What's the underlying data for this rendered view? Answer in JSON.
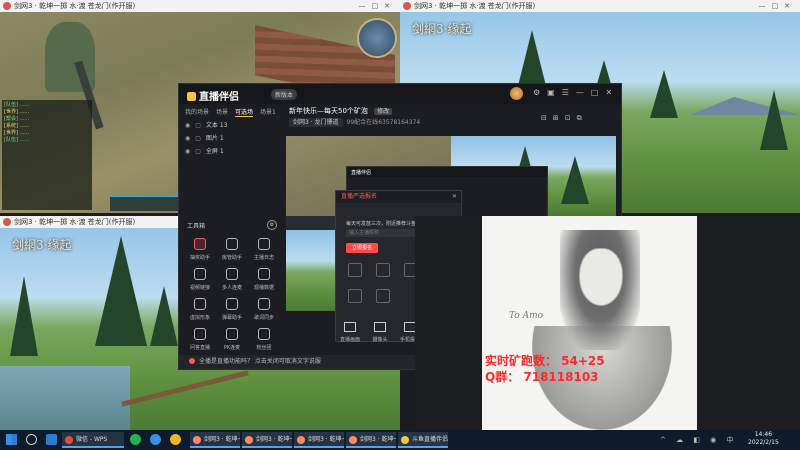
{
  "windows": {
    "top_left": {
      "title": "剑网3 · 乾坤一掷 水·渡 苍龙门(作开服)"
    },
    "top_right": {
      "title": "剑网3 · 乾坤一掷 水·渡 苍龙门(作开服)",
      "logo": "剑網3·缘起"
    },
    "bottom_left": {
      "title": "剑网3 · 乾坤一掷 水·渡 苍龙门(作开服)",
      "logo": "剑網3·缘起"
    }
  },
  "app": {
    "brand": "直播伴侣",
    "badge": "新版本",
    "tabs": [
      "我的场景",
      "场景",
      "可选场",
      "场景1"
    ],
    "active_tab_index": 2,
    "scenes": [
      {
        "label": "文本 13"
      },
      {
        "label": "图片 1"
      },
      {
        "label": "全屏 1"
      }
    ],
    "stream_title": "新年快乐—每天50个矿泡",
    "stream_tag": "修改",
    "stats": [
      "剑网3 · 龙门镖道",
      "99配合在线",
      "6357816",
      "4374"
    ],
    "header_icons": [
      "⚙",
      "▣",
      "☰",
      "—",
      "□",
      "✕"
    ],
    "toolbar_icons": [
      "⊟",
      "⊞",
      "⊡",
      "⧉"
    ],
    "tools": {
      "header": "工具箱",
      "settings_label": "⚙",
      "items": [
        {
          "label": "抽奖助手",
          "red": true
        },
        {
          "label": "房管助手",
          "red": false
        },
        {
          "label": "主播日志",
          "red": false
        },
        {
          "label": "视频链接",
          "red": false
        },
        {
          "label": "多人连麦",
          "red": false
        },
        {
          "label": "观播数据",
          "red": false
        },
        {
          "label": "虚拟形象",
          "red": false
        },
        {
          "label": "弹幕助手",
          "red": false
        },
        {
          "label": "歌词同步",
          "red": false
        },
        {
          "label": "问答直播",
          "red": false
        },
        {
          "label": "PK连麦",
          "red": false
        },
        {
          "label": "粉丝团",
          "red": false
        }
      ]
    },
    "notice": "全播是直播功能吗？ 点击关闭可取消文字说服",
    "bottom_actions": [
      "直播画面",
      "摄像头",
      "手机投屏"
    ]
  },
  "preview": {
    "inner_brand": "直播伴侣"
  },
  "popup": {
    "title": "直播严选报名",
    "close": "✕",
    "text": "每天可发放三次，附近推荐斗鱼",
    "input_placeholder": "输入主播昵称",
    "button": "立即报名"
  },
  "portrait": {
    "signature": "To Amo",
    "line1": "实时矿跑数：  54+25",
    "line2": "Q群：  718118103"
  },
  "taskbar": {
    "tasks": [
      {
        "label": "微信 - WPS",
        "color": "#e84b3c"
      },
      {
        "label": "剑网3 · 乾坤一掷",
        "color": "#ff8a65"
      },
      {
        "label": "剑网3 · 乾坤一掷",
        "color": "#ff8a65"
      },
      {
        "label": "剑网3 · 乾坤一掷",
        "color": "#ff8a65"
      },
      {
        "label": "剑网3 · 乾坤一掷",
        "color": "#ff8a65"
      },
      {
        "label": "斗鱼直播伴侣",
        "color": "#f6c344"
      }
    ],
    "time": "14:46",
    "date": "2022/2/15",
    "tray": "^ ☁ ◧ ◉ 中"
  }
}
